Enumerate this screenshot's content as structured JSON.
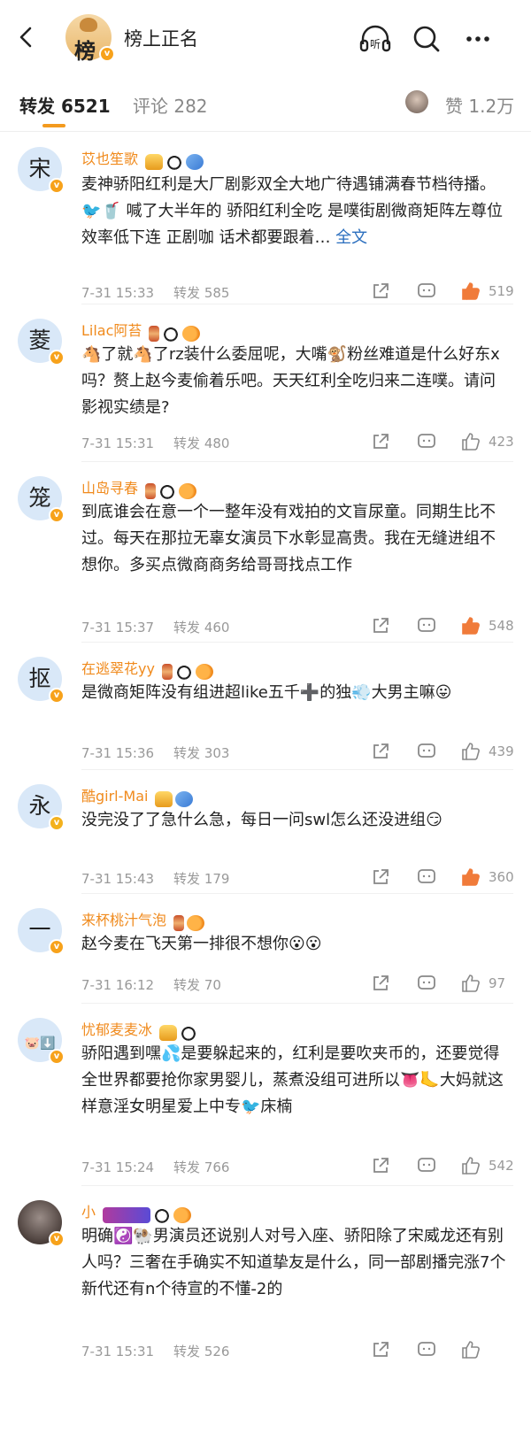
{
  "header": {
    "title": "榜上正名",
    "avatar_glyph": "榜",
    "listen_label": "听"
  },
  "tabs": {
    "repost": "转发 6521",
    "comment": "评论 282",
    "like": "赞 1.2万"
  },
  "accent": "#f39a1e",
  "comments": [
    {
      "avatar": "宋",
      "name": "苡也笙歌",
      "badges": [
        "crown",
        "panda",
        "blue"
      ],
      "text": "麦神骄阳红利是大厂剧影双全大地广待遇铺满春节档待播。🐦🥤 喊了大半年的 骄阳红利全吃 是噗街剧微商矩阵左尊位效率低下连 正剧咖 话术都要跟着…",
      "more": "全文",
      "time": "7-31 15:33",
      "reposts": "转发 585",
      "likes": "519",
      "liked": true
    },
    {
      "avatar": "菱",
      "name": "Lilac阿苔",
      "badges": [
        "hour",
        "panda",
        "fish"
      ],
      "text": "🐴了就🐴了rz装什么委屈呢，大嘴🐒粉丝难道是什么好东x吗？赘上赵今麦偷着乐吧。天天红利全吃归来二连噗。请问影视实绩是?",
      "more": "",
      "time": "7-31 15:31",
      "reposts": "转发 480",
      "likes": "423",
      "liked": false
    },
    {
      "avatar": "笼",
      "name": "山岛寻春",
      "badges": [
        "hour",
        "panda",
        "fish"
      ],
      "text": "到底谁会在意一个一整年没有戏拍的文盲尿童。同期生比不过。每天在那拉无辜女演员下水彰显高贵。我在无缝进组不想你。多买点微商商务给哥哥找点工作",
      "more": "",
      "time": "7-31 15:37",
      "reposts": "转发 460",
      "likes": "548",
      "liked": true
    },
    {
      "avatar": "抠",
      "name": "在逃翠花yy",
      "badges": [
        "hour",
        "panda",
        "fish"
      ],
      "text": "是微商矩阵没有组进超like五千➕的独💨大男主嘛😛",
      "more": "",
      "time": "7-31 15:36",
      "reposts": "转发 303",
      "likes": "439",
      "liked": false
    },
    {
      "avatar": "永",
      "name": "酷girl-Mai",
      "badges": [
        "crown",
        "blue"
      ],
      "text": "没完没了了急什么急，每日一问swl怎么还没进组😏",
      "more": "",
      "time": "7-31 15:43",
      "reposts": "转发 179",
      "likes": "360",
      "liked": true
    },
    {
      "avatar": "一",
      "name": "来杯桃汁气泡",
      "badges": [
        "hour",
        "fish"
      ],
      "text": "赵今麦在飞天第一排很不想你😮😮",
      "more": "",
      "time": "7-31 16:12",
      "reposts": "转发 70",
      "likes": "97",
      "liked": false
    },
    {
      "avatar": "🐷⬇️",
      "name": "忧郁麦麦冰",
      "badges": [
        "crown",
        "panda"
      ],
      "text": "骄阳遇到嘿💦是要躲起来的，红利是要吹夹币的，还要觉得全世界都要抢你家男婴儿，蒸煮没组可进所以👅🦶大妈就这样意淫女明星爱上中专🐦床楠",
      "more": "",
      "time": "7-31 15:24",
      "reposts": "转发 766",
      "likes": "542",
      "liked": false
    },
    {
      "avatar": "",
      "name": "小",
      "badges": [
        "purple",
        "panda",
        "fish"
      ],
      "text": "明确☯️🐏男演员还说别人对号入座、骄阳除了宋威龙还有别人吗？三奢在手确实不知道挚友是什么，同一部剧播完涨7个新代还有n个待宣的不懂-2的",
      "more": "",
      "time": "7-31 15:31",
      "reposts": "转发 526",
      "likes": "",
      "liked": false
    }
  ]
}
